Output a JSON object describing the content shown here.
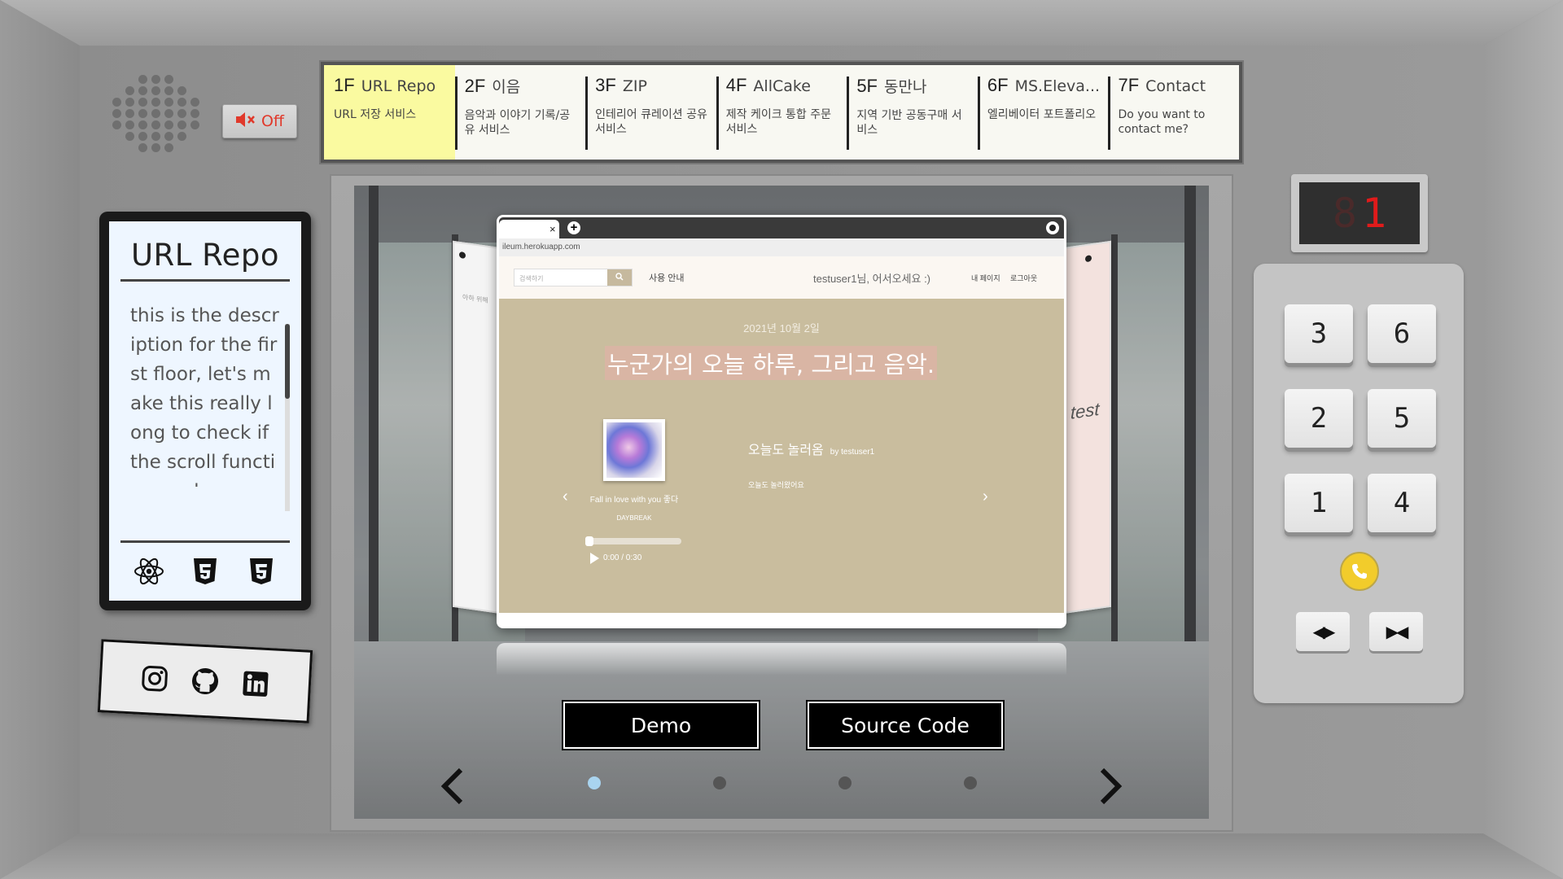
{
  "audio": {
    "mute_label": "Off",
    "mute_icon": "speaker-muted-icon",
    "color": "#e0392b"
  },
  "floors": [
    {
      "num": "1F",
      "name": "URL Repo",
      "desc": "URL 저장 서비스",
      "active": true
    },
    {
      "num": "2F",
      "name": "이음",
      "desc": "음악과 이야기 기록/공유 서비스"
    },
    {
      "num": "3F",
      "name": "ZIP",
      "desc": "인테리어 큐레이션 공유 서비스"
    },
    {
      "num": "4F",
      "name": "AllCake",
      "desc": "제작 케이크 통합 주문 서비스"
    },
    {
      "num": "5F",
      "name": "동만나",
      "desc": "지역 기반 공동구매 서비스"
    },
    {
      "num": "6F",
      "name": "MS.Eleva...",
      "desc": "엘리베이터 포트폴리오"
    },
    {
      "num": "7F",
      "name": "Contact",
      "desc": "Do you want to contact me?"
    }
  ],
  "info": {
    "title": "URL Repo",
    "description": "this is the description for the first floor, let's make this really long to check if the scroll function works",
    "tech_icons": [
      "react-icon",
      "html5-icon",
      "css3-icon"
    ]
  },
  "social": [
    "instagram-icon",
    "github-icon",
    "linkedin-icon"
  ],
  "preview": {
    "url": "ileum.herokuapp.com",
    "tab_close": "×",
    "tab_add": "+",
    "search_placeholder": "검색하기",
    "nav_guide": "사용 안내",
    "greeting": "testuser1님, 어서오세요 :)",
    "my_page": "내 페이지",
    "logout": "로그아웃",
    "date": "2021년 10월 2일",
    "hero_title": "누군가의 오늘 하루, 그리고 음악.",
    "song_title": "Fall in love with you 좋다",
    "song_artist": "DAYBREAK",
    "player_time": "0:00 / 0:30",
    "post_title": "오늘도 놀러옴",
    "post_by": "by testuser1",
    "post_body": "오늘도 놀러왔어요",
    "side_left_text": "아하 위해",
    "side_right_text": "test"
  },
  "buttons": {
    "demo": "Demo",
    "source": "Source Code"
  },
  "pager": {
    "count": 4,
    "active_index": 0
  },
  "display": {
    "digits_ghost": "8",
    "digit_lit": "1",
    "lit_color": "#e01b1b"
  },
  "keypad": {
    "keys": [
      "3",
      "6",
      "2",
      "5",
      "1",
      "4"
    ],
    "call_icon": "phone-icon",
    "door_open": "◀▶",
    "door_close": "▶◀"
  }
}
